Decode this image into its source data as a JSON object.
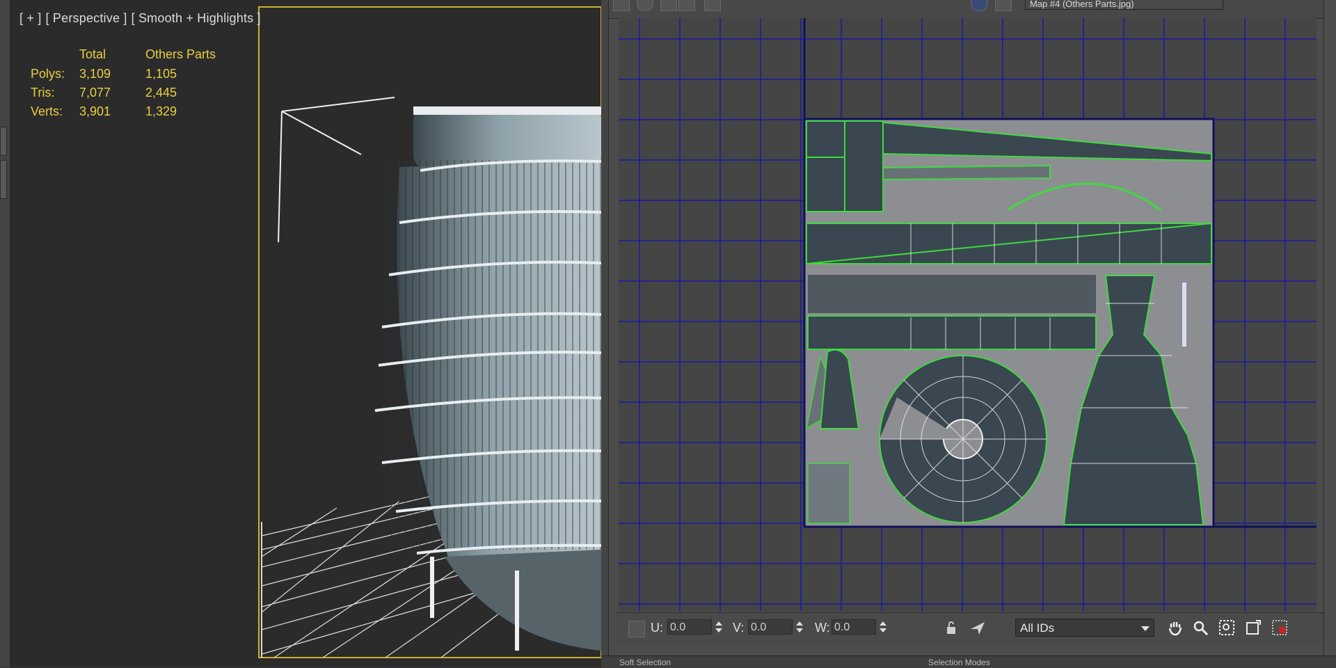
{
  "viewport": {
    "labels": [
      "[ + ]",
      "[ Perspective ]",
      "[ Smooth + Highlights ]"
    ],
    "stats": {
      "headers": {
        "total": "Total",
        "selection": "Others Parts"
      },
      "rows": [
        {
          "label": "Polys:",
          "total": "3,109",
          "selection": "1,105"
        },
        {
          "label": "Tris:",
          "total": "7,077",
          "selection": "2,445"
        },
        {
          "label": "Verts:",
          "total": "3,901",
          "selection": "1,329"
        }
      ]
    }
  },
  "uv_editor": {
    "map_dropdown": "Map #4 (Others Parts.jpg)",
    "u_label": "U:",
    "u_value": "0.0",
    "v_label": "V:",
    "v_value": "0.0",
    "w_label": "W:",
    "w_value": "0.0",
    "ids_dropdown": "All IDs"
  },
  "bottom": {
    "soft_selection": "Soft Selection",
    "selection_modes": "Selection Modes"
  },
  "colors": {
    "viewport_border": "#c8b432",
    "stat_text": "#e8d040",
    "uv_grid": "#1a1aa8",
    "uv_seam": "#3cdc3c"
  }
}
